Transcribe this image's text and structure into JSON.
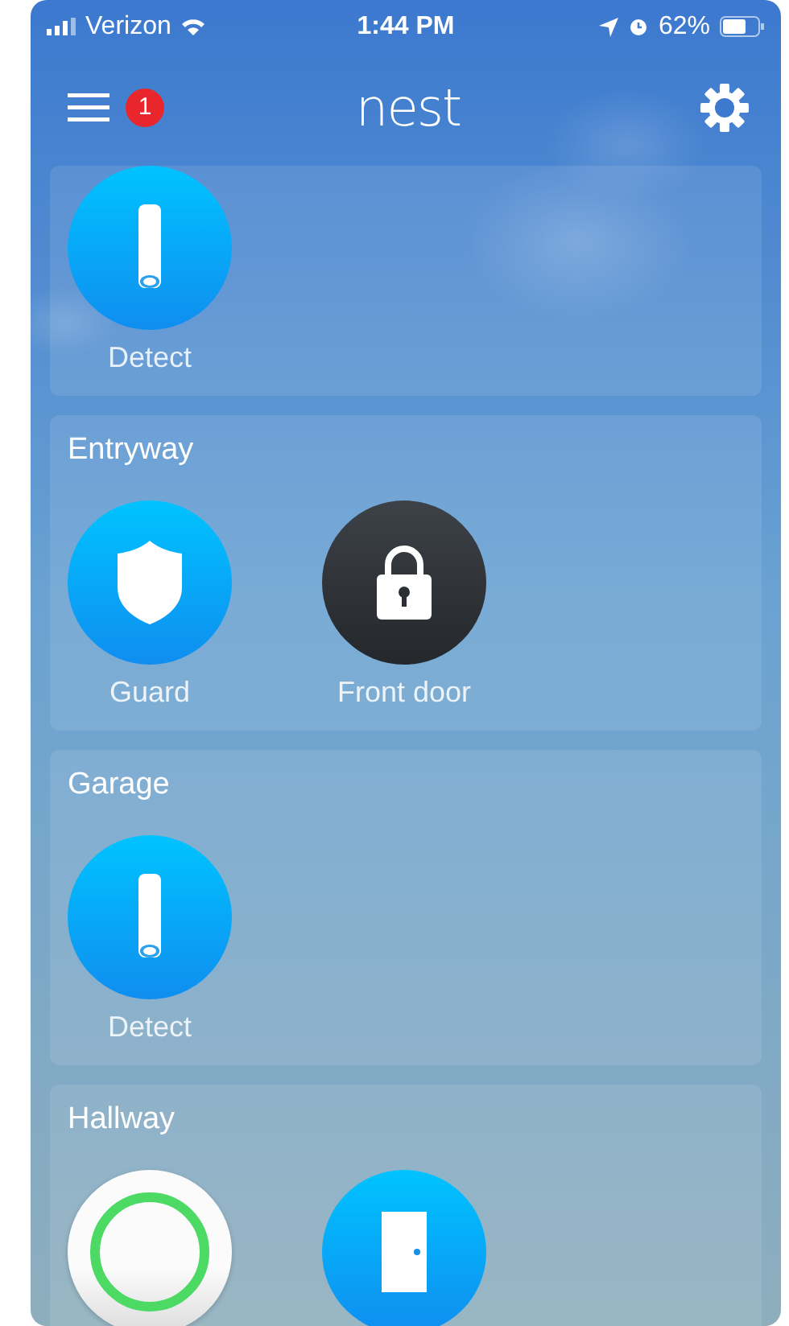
{
  "status_bar": {
    "carrier": "Verizon",
    "time": "1:44 PM",
    "battery": "62%"
  },
  "nav_bar": {
    "badge": "1",
    "logo": "nest"
  },
  "rooms": [
    {
      "devices": [
        {
          "kind": "sensor",
          "label": "Detect"
        }
      ]
    },
    {
      "name": "Entryway",
      "devices": [
        {
          "kind": "guard",
          "label": "Guard"
        },
        {
          "kind": "lock",
          "label": "Front door"
        }
      ]
    },
    {
      "name": "Garage",
      "devices": [
        {
          "kind": "sensor",
          "label": "Detect"
        }
      ]
    },
    {
      "name": "Hallway",
      "devices": [
        {
          "kind": "ring"
        },
        {
          "kind": "door"
        }
      ]
    }
  ]
}
